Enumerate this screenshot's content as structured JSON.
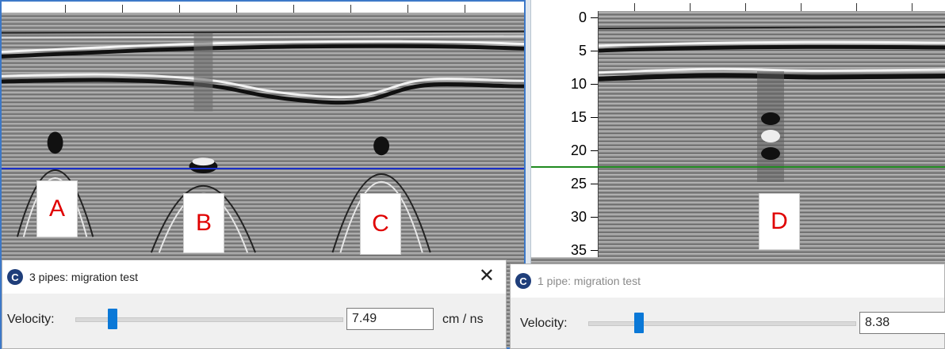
{
  "left_panel": {
    "markers": [
      "A",
      "B",
      "C"
    ],
    "line_color": "#1a2fc8"
  },
  "right_panel": {
    "markers": [
      "D"
    ],
    "line_color": "#1f8a1f",
    "depth_axis": [
      "0",
      "5",
      "10",
      "15",
      "20",
      "25",
      "30",
      "35"
    ]
  },
  "dialog_left": {
    "title": "3 pipes: migration test",
    "velocity_label": "Velocity:",
    "velocity_value": "7.49",
    "unit": "cm / ns",
    "close_symbol": "✕",
    "slider_fraction": 0.14
  },
  "dialog_right": {
    "title": "1 pipe: migration test",
    "velocity_label": "Velocity:",
    "velocity_value": "8.38",
    "slider_fraction": 0.19
  },
  "colors": {
    "accent": "#0a78d7",
    "marker_text": "#e00000",
    "app_icon": "#1f3e7a"
  }
}
